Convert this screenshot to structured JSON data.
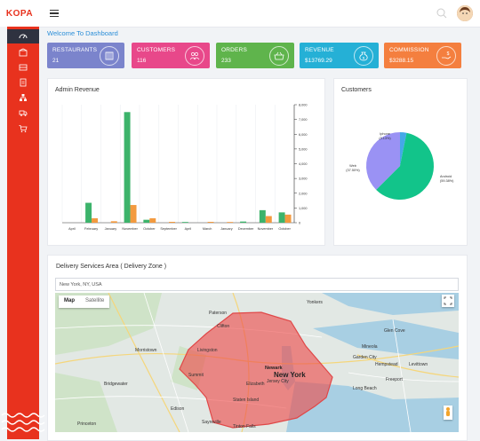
{
  "brand": {
    "logo_text": "KOPA"
  },
  "sidebar": {
    "icons": [
      "dashboard-icon",
      "restaurant-icon",
      "food-icon",
      "receipt-icon",
      "org-icon",
      "delivery-icon",
      "cart-icon"
    ]
  },
  "header": {
    "welcome": "Welcome To Dashboard"
  },
  "stats": [
    {
      "title": "RESTAURANTS",
      "value": "21",
      "color": "#7b84cc",
      "icon": "building-icon"
    },
    {
      "title": "CUSTOMERS",
      "value": "116",
      "color": "#e8488a",
      "icon": "users-icon"
    },
    {
      "title": "ORDERS",
      "value": "233",
      "color": "#5fb44c",
      "icon": "basket-icon"
    },
    {
      "title": "REVENUE",
      "value": "$13769.29",
      "color": "#25b0d6",
      "icon": "money-bag-icon"
    },
    {
      "title": "COMMISSION",
      "value": "$3288.15",
      "color": "#f47f3f",
      "icon": "hand-money-icon"
    }
  ],
  "revenue_card": {
    "title": "Admin Revenue"
  },
  "customers_card": {
    "title": "Customers"
  },
  "chart_data": [
    {
      "type": "bar",
      "title": "Admin Revenue",
      "categories": [
        "April",
        "February",
        "January",
        "November",
        "October",
        "September",
        "April",
        "March",
        "January",
        "December",
        "November",
        "October"
      ],
      "series": [
        {
          "values": [
            0,
            1350,
            0,
            7500,
            200,
            0,
            50,
            0,
            0,
            80,
            850,
            700
          ],
          "color": "#3cb36b"
        },
        {
          "values": [
            0,
            300,
            100,
            1200,
            300,
            60,
            0,
            60,
            50,
            0,
            450,
            550
          ],
          "color": "#f39a3f"
        }
      ],
      "ylim": [
        0,
        8000
      ],
      "yticks": [
        "0",
        "1,000",
        "2,000",
        "3,000",
        "4,000",
        "5,000",
        "6,000",
        "7,000",
        "8,000"
      ],
      "grid": true
    },
    {
      "type": "pie",
      "title": "Customers",
      "slices": [
        {
          "label": "Android",
          "pct_label": "(59.38%)",
          "value": 59.38,
          "color": "#12c48a"
        },
        {
          "label": "Web",
          "pct_label": "(37.50%)",
          "value": 37.5,
          "color": "#9a92f4"
        },
        {
          "label": "Iphone",
          "pct_label": "(3.13%)",
          "value": 3.13,
          "color": "#44a8e8"
        }
      ]
    }
  ],
  "map": {
    "title": "Delivery Services Area ( Delivery Zone )",
    "search_value": "New York, NY, USA",
    "map_button": "Map",
    "satellite_button": "Satellite",
    "labels": [
      "Paterson",
      "Clifton",
      "Yonkers",
      "Newark",
      "New York",
      "Elizabeth",
      "Jersey City",
      "Morristown",
      "Livingston",
      "Summit",
      "Edison",
      "Sayreville",
      "Staten Island",
      "Glen Cove",
      "Hempstead",
      "Garden City",
      "Mineola",
      "Levittown",
      "Long Beach",
      "Freeport",
      "Tinton Falls",
      "Bridgewater",
      "Princeton"
    ]
  }
}
